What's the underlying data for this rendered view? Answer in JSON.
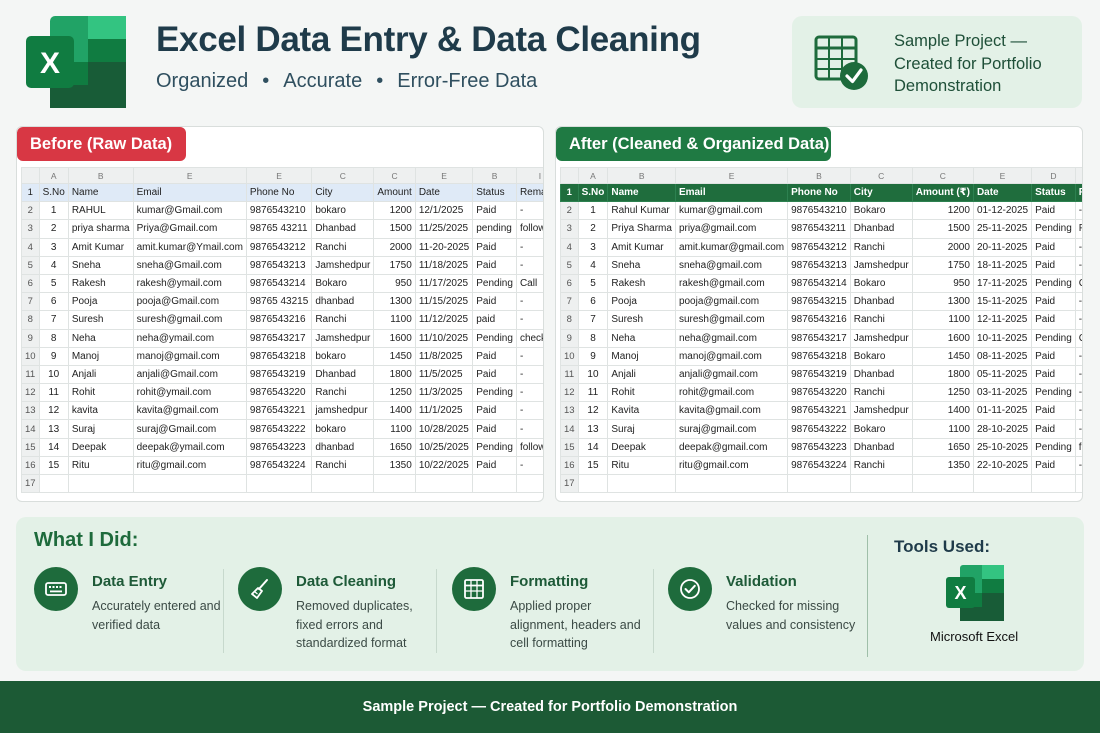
{
  "header": {
    "title": "Excel Data Entry & Data Cleaning",
    "subtitle_items": [
      "Organized",
      "Accurate",
      "Error-Free Data"
    ],
    "separator": "•",
    "sample_card": {
      "text": "Sample Project — Created for Portfolio Demonstration"
    }
  },
  "before": {
    "tag": "Before (Raw Data)",
    "col_letters": [
      "A",
      "B",
      "E",
      "E",
      "C",
      "C",
      "E",
      "B",
      "I"
    ],
    "headers": [
      "S.No",
      "Name",
      "Email",
      "Phone No",
      "City",
      "Amount",
      "Date",
      "Status",
      "Remarks"
    ],
    "rows": [
      [
        "1",
        "RAHUL",
        "kumar@Gmail.com",
        "9876543210",
        "bokaro",
        "1200",
        "12/1/2025",
        "Paid",
        "-"
      ],
      [
        "2",
        "priya sharma",
        "Priya@Gmail.com",
        "98765 43211",
        "Dhanbad",
        "1500",
        "11/25/2025",
        "pending",
        "follow up"
      ],
      [
        "3",
        "Amit Kumar",
        "amit.kumar@Ymail.com",
        "9876543212",
        "Ranchi",
        "2000",
        "11-20-2025",
        "Paid",
        "-"
      ],
      [
        "4",
        "Sneha",
        "sneha@Gmail.com",
        "9876543213",
        "Jamshedpur",
        "1750",
        "11/18/2025",
        "Paid",
        "-"
      ],
      [
        "5",
        "Rakesh",
        "rakesh@ymail.com",
        "9876543214",
        "Bokaro",
        "950",
        "11/17/2025",
        "Pending",
        "Call"
      ],
      [
        "6",
        "Pooja",
        "pooja@Gmail.com",
        "98765 43215",
        "dhanbad",
        "1300",
        "11/15/2025",
        "Paid",
        "-"
      ],
      [
        "7",
        "Suresh",
        "suresh@gmail.com",
        "9876543216",
        "Ranchi",
        "1100",
        "11/12/2025",
        "paid",
        "-"
      ],
      [
        "8",
        "Neha",
        "neha@ymail.com",
        "9876543217",
        "Jamshedpur",
        "1600",
        "11/10/2025",
        "Pending",
        "check"
      ],
      [
        "9",
        "Manoj",
        "manoj@gmail.com",
        "9876543218",
        "bokaro",
        "1450",
        "11/8/2025",
        "Paid",
        "-"
      ],
      [
        "10",
        "Anjali",
        "anjali@Gmail.com",
        "9876543219",
        "Dhanbad",
        "1800",
        "11/5/2025",
        "Paid",
        "-"
      ],
      [
        "11",
        "Rohit",
        "rohit@ymail.com",
        "9876543220",
        "Ranchi",
        "1250",
        "11/3/2025",
        "Pending",
        "-"
      ],
      [
        "12",
        "kavita",
        "kavita@gmail.com",
        "9876543221",
        "jamshedpur",
        "1400",
        "11/1/2025",
        "Paid",
        "-"
      ],
      [
        "13",
        "Suraj",
        "suraj@Gmail.com",
        "9876543222",
        "bokaro",
        "1100",
        "10/28/2025",
        "Paid",
        "-"
      ],
      [
        "14",
        "Deepak",
        "deepak@ymail.com",
        "9876543223",
        "dhanbad",
        "1650",
        "10/25/2025",
        "Pending",
        "follow up"
      ],
      [
        "15",
        "Ritu",
        "ritu@gmail.com",
        "9876543224",
        "Ranchi",
        "1350",
        "10/22/2025",
        "Paid",
        "-"
      ]
    ]
  },
  "after": {
    "tag": "After (Cleaned & Organized Data)",
    "col_letters": [
      "A",
      "B",
      "E",
      "B",
      "C",
      "C",
      "E",
      "D",
      "I"
    ],
    "headers": [
      "S.No",
      "Name",
      "Email",
      "Phone No",
      "City",
      "Amount (₹)",
      "Date",
      "Status",
      "Remarks"
    ],
    "rows": [
      [
        "1",
        "Rahul Kumar",
        "kumar@gmail.com",
        "9876543210",
        "Bokaro",
        "1200",
        "01-12-2025",
        "Paid",
        "-"
      ],
      [
        "2",
        "Priya Sharma",
        "priya@gmail.com",
        "9876543211",
        "Dhanbad",
        "1500",
        "25-11-2025",
        "Pending",
        "Follow up"
      ],
      [
        "3",
        "Amit Kumar",
        "amit.kumar@gmail.com",
        "9876543212",
        "Ranchi",
        "2000",
        "20-11-2025",
        "Paid",
        "-"
      ],
      [
        "4",
        "Sneha",
        "sneha@gmail.com",
        "9876543213",
        "Jamshedpur",
        "1750",
        "18-11-2025",
        "Paid",
        "-"
      ],
      [
        "5",
        "Rakesh",
        "rakesh@gmail.com",
        "9876543214",
        "Bokaro",
        "950",
        "17-11-2025",
        "Pending",
        "Call"
      ],
      [
        "6",
        "Pooja",
        "pooja@gmail.com",
        "9876543215",
        "Dhanbad",
        "1300",
        "15-11-2025",
        "Paid",
        "-"
      ],
      [
        "7",
        "Suresh",
        "suresh@gmail.com",
        "9876543216",
        "Ranchi",
        "1100",
        "12-11-2025",
        "Paid",
        "-"
      ],
      [
        "8",
        "Neha",
        "neha@gmail.com",
        "9876543217",
        "Jamshedpur",
        "1600",
        "10-11-2025",
        "Pending",
        "Check"
      ],
      [
        "9",
        "Manoj",
        "manoj@gmail.com",
        "9876543218",
        "Bokaro",
        "1450",
        "08-11-2025",
        "Paid",
        "-"
      ],
      [
        "10",
        "Anjali",
        "anjali@gmail.com",
        "9876543219",
        "Dhanbad",
        "1800",
        "05-11-2025",
        "Paid",
        "-"
      ],
      [
        "11",
        "Rohit",
        "rohit@gmail.com",
        "9876543220",
        "Ranchi",
        "1250",
        "03-11-2025",
        "Pending",
        "-"
      ],
      [
        "12",
        "Kavita",
        "kavita@gmail.com",
        "9876543221",
        "Jamshedpur",
        "1400",
        "01-11-2025",
        "Paid",
        "-"
      ],
      [
        "13",
        "Suraj",
        "suraj@gmail.com",
        "9876543222",
        "Bokaro",
        "1100",
        "28-10-2025",
        "Paid",
        "-"
      ],
      [
        "14",
        "Deepak",
        "deepak@gmail.com",
        "9876543223",
        "Dhanbad",
        "1650",
        "25-10-2025",
        "Pending",
        "follow up"
      ],
      [
        "15",
        "Ritu",
        "ritu@gmail.com",
        "9876543224",
        "Ranchi",
        "1350",
        "22-10-2025",
        "Paid",
        "-"
      ]
    ]
  },
  "what_i_did": {
    "title": "What I Did:",
    "items": [
      {
        "icon": "keyboard-icon",
        "title": "Data Entry",
        "desc": "Accurately entered and verified data"
      },
      {
        "icon": "broom-icon",
        "title": "Data Cleaning",
        "desc": "Removed duplicates, fixed errors and standardized format"
      },
      {
        "icon": "table-icon",
        "title": "Formatting",
        "desc": "Applied proper alignment, headers and cell formatting"
      },
      {
        "icon": "check-circle-icon",
        "title": "Validation",
        "desc": "Checked for missing values and consistency"
      }
    ]
  },
  "tools": {
    "title": "Tools Used:",
    "logo_letter": "X",
    "label": "Microsoft Excel"
  },
  "footer": {
    "text": "Sample Project — Created for Portfolio Demonstration"
  },
  "colors": {
    "excel_green": "#1f7a43",
    "dark_green": "#1c5a35",
    "raw_red": "#d83744",
    "card_bg": "#e3f1e7"
  }
}
